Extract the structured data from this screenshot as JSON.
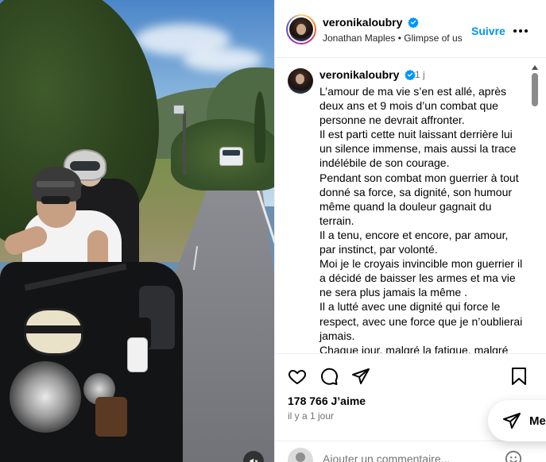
{
  "post": {
    "username": "veronikaloubry",
    "subtitle": "Jonathan Maples • Glimpse of us",
    "follow_label": "Suivre",
    "caption": {
      "username": "veronikaloubry",
      "time": "1 j",
      "text": "L’amour de ma vie s’en est allé, après deux ans et 9 mois d’un combat que personne ne devrait affronter.\nIl est parti cette nuit laissant derrière lui un silence immense, mais aussi la trace indélébile de son courage.\nPendant son combat mon guerrier à tout donné sa force, sa dignité, son humour même quand la douleur gagnait du terrain.\nIl a tenu, encore et encore, par amour, par instinct, par volonté.\nMoi je le croyais invincible mon guerrier il a décidé de baisser les armes et ma vie ne sera plus jamais la même .\nIl a lutté avec une dignité qui force le respect, avec une force que je n’oublierai jamais.\nChaque jour, malgré la fatigue, malgré"
    },
    "likes": "178 766 J’aime",
    "time_ago": "il y a 1 jour",
    "comment_placeholder": "Ajouter un commentaire..."
  },
  "messages": {
    "label": "Me"
  },
  "icons": {
    "verified": "verified-badge-icon",
    "more": "more-options-icon",
    "like": "heart-icon",
    "comment": "comment-icon",
    "share": "share-icon",
    "save": "bookmark-icon",
    "emoji": "emoji-icon",
    "mute": "mute-icon",
    "messages": "send-icon"
  },
  "colors": {
    "accent": "#0095f6",
    "verified": "#0095f6",
    "secondary_text": "#737373"
  }
}
